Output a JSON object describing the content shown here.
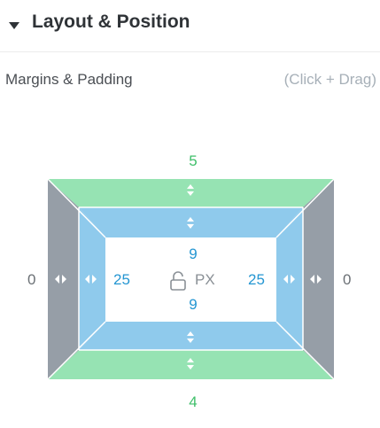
{
  "section": {
    "title": "Layout & Position",
    "caret_icon": "caret-down-icon"
  },
  "spacing": {
    "label": "Margins & Padding",
    "hint": "(Click + Drag)",
    "unit": "PX",
    "margin": {
      "top": "5",
      "right": "0",
      "bottom": "4",
      "left": "0"
    },
    "padding": {
      "top": "9",
      "right": "25",
      "bottom": "9",
      "left": "25"
    },
    "colors": {
      "margin_vertical": "#96e3b3",
      "margin_horizontal": "#969ea7",
      "padding": "#8fcaec",
      "margin_text": "#3fbf6a",
      "padding_text": "#2496d2"
    }
  }
}
